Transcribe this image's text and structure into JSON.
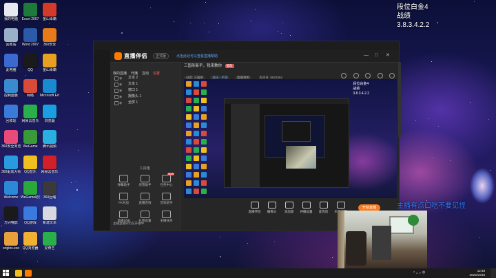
{
  "overlay": {
    "line1": "段位白金4",
    "line2": "战绩",
    "line3": "3.8.3.4.2.2"
  },
  "scrolling_text": "主播有点口吃不要见怪",
  "desktop_icons": [
    {
      "label": "我的电脑",
      "color": "#e8e8f0"
    },
    {
      "label": "Excel 2007",
      "color": "#1e7a3a"
    },
    {
      "label": "金山毒霸",
      "color": "#d43a2a"
    },
    {
      "label": "回收站",
      "color": "#9ab0c8"
    },
    {
      "label": "Word 2007",
      "color": "#2a5aa8"
    },
    {
      "label": "360安全",
      "color": "#e87a1a"
    },
    {
      "label": "此电脑",
      "color": "#3a6ad0"
    },
    {
      "label": "QQ",
      "color": "#1a1a1a"
    },
    {
      "label": "金山毒霸",
      "color": "#e8a020"
    },
    {
      "label": "控制面板",
      "color": "#3a8ad0"
    },
    {
      "label": "网络",
      "color": "#d84a3a"
    },
    {
      "label": "Microsoft Edge",
      "color": "#1a8ad0"
    },
    {
      "label": "回收站",
      "color": "#3a7ad8"
    },
    {
      "label": "网易云音乐",
      "color": "#2ab04a"
    },
    {
      "label": "浏览器",
      "color": "#1aa0e0"
    },
    {
      "label": "360安全浏览器",
      "color": "#e84a7a"
    },
    {
      "label": "WeGame",
      "color": "#3a9a3a"
    },
    {
      "label": "腾讯视频",
      "color": "#2ab0e0"
    },
    {
      "label": "360驱动大师",
      "color": "#2a9ae0"
    },
    {
      "label": "QQ音乐",
      "color": "#f0c020"
    },
    {
      "label": "网易云音乐",
      "color": "#d0202a"
    },
    {
      "label": "Welcome",
      "color": "#2a8ad8"
    },
    {
      "label": "WeGame助手",
      "color": "#2aa83a"
    },
    {
      "label": "360压缩",
      "color": "#3a3a3a"
    },
    {
      "label": "万兴喵影",
      "color": "#1a1a1a"
    },
    {
      "label": "QQ游戏",
      "color": "#3a7ae0"
    },
    {
      "label": "新建文本",
      "color": "#d8d8e0"
    },
    {
      "label": "origins.exe",
      "color": "#e8a03a"
    },
    {
      "label": "QQ浏览器",
      "color": "#f0b030"
    },
    {
      "label": "爱奇艺",
      "color": "#2ab04a"
    }
  ],
  "window": {
    "app_title": "直播伴侣",
    "version_label": "正式版",
    "notice": "点击此处可以查看直播帮助",
    "controls": [
      "—",
      "□",
      "✕"
    ]
  },
  "panel": {
    "tabs": [
      {
        "label": "我的直播",
        "active": false
      },
      {
        "label": "开播",
        "active": false
      },
      {
        "label": "互动",
        "active": false
      },
      {
        "label": "设置",
        "active": true
      }
    ],
    "scenes": [
      "文本 2",
      "文本 1",
      "窗口 1",
      "摄像头 1",
      "全屏 1"
    ],
    "tools_title": "工具箱",
    "tools": [
      {
        "label": "弹幕助手",
        "badge": ""
      },
      {
        "label": "房管助手",
        "badge": ""
      },
      {
        "label": "任务中心",
        "badge": "NEW"
      },
      {
        "label": "PK对战",
        "badge": ""
      },
      {
        "label": "直播连线",
        "badge": ""
      },
      {
        "label": "音效助手",
        "badge": ""
      },
      {
        "label": "直播记录",
        "badge": ""
      },
      {
        "label": "礼物设置",
        "badge": ""
      },
      {
        "label": "主播任务",
        "badge": ""
      }
    ],
    "footer": "主播直播间仍在开播中"
  },
  "info": {
    "room_title": "三国杀新手，我来教你",
    "edit_button": "修改",
    "tags": [
      {
        "label": "分区: 三国杀",
        "highlight": false
      },
      {
        "label": "娱乐 · 手游",
        "highlight": true
      },
      {
        "label": "直播清晰",
        "highlight": false
      }
    ],
    "room_number": "房间号: 8822562"
  },
  "preview": {
    "line1": "段位白金4",
    "line2": "战绩",
    "line3": "3.8.3.4.2.2"
  },
  "bottom_controls": [
    {
      "label": "直播伴侣"
    },
    {
      "label": "摄像头"
    },
    {
      "label": "添加源"
    },
    {
      "label": "开播设置"
    },
    {
      "label": "麦克风"
    },
    {
      "label": "声音调节"
    }
  ],
  "start_button": "开始直播",
  "taskbar": {
    "time": "12:48",
    "date": "2020/10/18"
  }
}
